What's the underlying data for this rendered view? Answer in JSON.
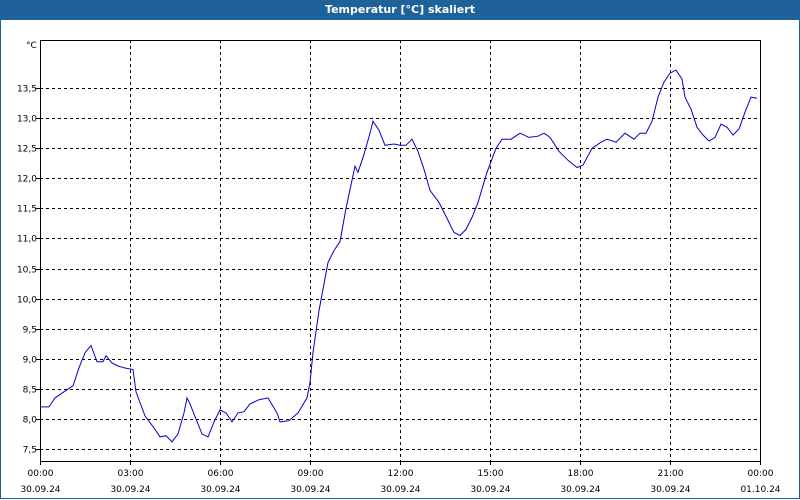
{
  "window": {
    "title": "Temperatur [°C] skaliert"
  },
  "chart_data": {
    "type": "line",
    "title": "Temperatur [°C] skaliert",
    "y_unit_label": "°C",
    "ylim": [
      7.3,
      14.3
    ],
    "y_ticks": [
      7.5,
      8.0,
      8.5,
      9.0,
      9.5,
      10.0,
      10.5,
      11.0,
      11.5,
      12.0,
      12.5,
      13.0,
      13.5
    ],
    "y_tick_labels": [
      "7,5",
      "8,0",
      "8,5",
      "9,0",
      "9,5",
      "10,0",
      "10,5",
      "11,0",
      "11,5",
      "12,0",
      "12,5",
      "13,0",
      "13,5"
    ],
    "xlim": [
      0,
      24
    ],
    "x_ticks": [
      0,
      3,
      6,
      9,
      12,
      15,
      18,
      21,
      24
    ],
    "x_tick_labels": [
      [
        "00:00",
        "30.09.24"
      ],
      [
        "03:00",
        "30.09.24"
      ],
      [
        "06:00",
        "30.09.24"
      ],
      [
        "09:00",
        "30.09.24"
      ],
      [
        "12:00",
        "30.09.24"
      ],
      [
        "15:00",
        "30.09.24"
      ],
      [
        "18:00",
        "30.09.24"
      ],
      [
        "21:00",
        "30.09.24"
      ],
      [
        "00:00",
        "01.10.24"
      ]
    ],
    "grid": true,
    "line_color": "#0000cc",
    "series": [
      {
        "values": [
          [
            0.0,
            8.2
          ],
          [
            0.3,
            8.2
          ],
          [
            0.5,
            8.35
          ],
          [
            0.8,
            8.45
          ],
          [
            1.1,
            8.55
          ],
          [
            1.3,
            8.85
          ],
          [
            1.5,
            9.1
          ],
          [
            1.7,
            9.22
          ],
          [
            1.9,
            8.95
          ],
          [
            2.1,
            8.95
          ],
          [
            2.2,
            9.05
          ],
          [
            2.4,
            8.93
          ],
          [
            2.6,
            8.88
          ],
          [
            2.8,
            8.85
          ],
          [
            3.1,
            8.82
          ],
          [
            3.2,
            8.45
          ],
          [
            3.5,
            8.05
          ],
          [
            3.8,
            7.85
          ],
          [
            4.0,
            7.7
          ],
          [
            4.2,
            7.72
          ],
          [
            4.4,
            7.62
          ],
          [
            4.6,
            7.75
          ],
          [
            4.8,
            8.1
          ],
          [
            4.9,
            8.35
          ],
          [
            5.0,
            8.25
          ],
          [
            5.2,
            8.0
          ],
          [
            5.4,
            7.75
          ],
          [
            5.6,
            7.7
          ],
          [
            5.8,
            7.95
          ],
          [
            6.0,
            8.15
          ],
          [
            6.2,
            8.1
          ],
          [
            6.4,
            7.95
          ],
          [
            6.6,
            8.1
          ],
          [
            6.8,
            8.12
          ],
          [
            7.0,
            8.25
          ],
          [
            7.3,
            8.32
          ],
          [
            7.6,
            8.35
          ],
          [
            7.9,
            8.1
          ],
          [
            8.0,
            7.95
          ],
          [
            8.3,
            7.97
          ],
          [
            8.6,
            8.1
          ],
          [
            8.9,
            8.35
          ],
          [
            9.0,
            8.6
          ],
          [
            9.1,
            9.1
          ],
          [
            9.3,
            9.8
          ],
          [
            9.6,
            10.6
          ],
          [
            9.8,
            10.8
          ],
          [
            10.0,
            10.95
          ],
          [
            10.2,
            11.5
          ],
          [
            10.5,
            12.2
          ],
          [
            10.6,
            12.1
          ],
          [
            10.8,
            12.4
          ],
          [
            11.0,
            12.75
          ],
          [
            11.1,
            12.95
          ],
          [
            11.3,
            12.8
          ],
          [
            11.5,
            12.55
          ],
          [
            11.8,
            12.57
          ],
          [
            12.0,
            12.55
          ],
          [
            12.2,
            12.55
          ],
          [
            12.4,
            12.65
          ],
          [
            12.6,
            12.45
          ],
          [
            12.8,
            12.15
          ],
          [
            13.0,
            11.8
          ],
          [
            13.3,
            11.6
          ],
          [
            13.5,
            11.4
          ],
          [
            13.8,
            11.1
          ],
          [
            14.0,
            11.05
          ],
          [
            14.2,
            11.15
          ],
          [
            14.4,
            11.35
          ],
          [
            14.6,
            11.6
          ],
          [
            14.9,
            12.1
          ],
          [
            15.2,
            12.5
          ],
          [
            15.4,
            12.65
          ],
          [
            15.7,
            12.65
          ],
          [
            16.0,
            12.75
          ],
          [
            16.3,
            12.68
          ],
          [
            16.6,
            12.7
          ],
          [
            16.8,
            12.75
          ],
          [
            17.0,
            12.68
          ],
          [
            17.3,
            12.45
          ],
          [
            17.6,
            12.3
          ],
          [
            17.9,
            12.18
          ],
          [
            18.1,
            12.22
          ],
          [
            18.4,
            12.5
          ],
          [
            18.7,
            12.6
          ],
          [
            18.9,
            12.65
          ],
          [
            19.2,
            12.6
          ],
          [
            19.5,
            12.75
          ],
          [
            19.8,
            12.65
          ],
          [
            20.0,
            12.75
          ],
          [
            20.2,
            12.75
          ],
          [
            20.4,
            12.95
          ],
          [
            20.6,
            13.35
          ],
          [
            20.8,
            13.6
          ],
          [
            21.0,
            13.75
          ],
          [
            21.2,
            13.8
          ],
          [
            21.4,
            13.65
          ],
          [
            21.5,
            13.35
          ],
          [
            21.7,
            13.15
          ],
          [
            21.9,
            12.85
          ],
          [
            22.1,
            12.72
          ],
          [
            22.3,
            12.62
          ],
          [
            22.5,
            12.68
          ],
          [
            22.7,
            12.9
          ],
          [
            22.9,
            12.85
          ],
          [
            23.1,
            12.72
          ],
          [
            23.3,
            12.82
          ],
          [
            23.5,
            13.1
          ],
          [
            23.7,
            13.35
          ],
          [
            23.9,
            13.33
          ]
        ]
      }
    ]
  }
}
